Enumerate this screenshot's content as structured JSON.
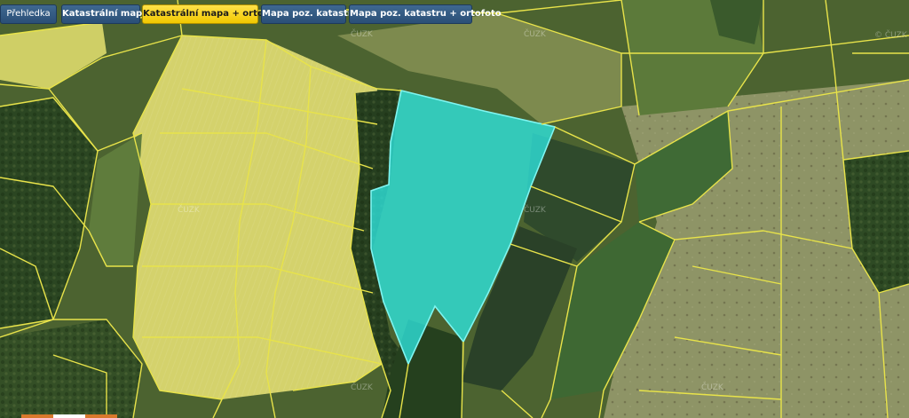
{
  "tabs": [
    {
      "label": "Přehledka",
      "active": false
    },
    {
      "label": "Katastrální mapa",
      "active": false
    },
    {
      "label": "Katastrální mapa + ortofoto",
      "active": true
    },
    {
      "label": "Mapa poz. katastru",
      "active": false
    },
    {
      "label": "Mapa poz. katastru + ortofoto",
      "active": false
    }
  ],
  "watermarks": [
    "© ČUZK",
    "ČUZK",
    "ČUZK",
    "ČUZK",
    "ČUZK",
    "ČUZK",
    "ČUZK"
  ],
  "colors": {
    "parcel_boundary": "#e8e34a",
    "highlighted_parcel": "#2ee6e0",
    "rapeseed_field": "#d6d36a",
    "forest": "#2c4a22",
    "meadow": "#8a9a55",
    "tab_active": "#f5cf12",
    "tab_inactive": "#2f557d",
    "scale_bar": "#d9782c"
  },
  "layers": {
    "basemap": "orthophoto",
    "overlay": "cadastral-parcel-boundaries",
    "selection": "highlighted-parcel"
  }
}
